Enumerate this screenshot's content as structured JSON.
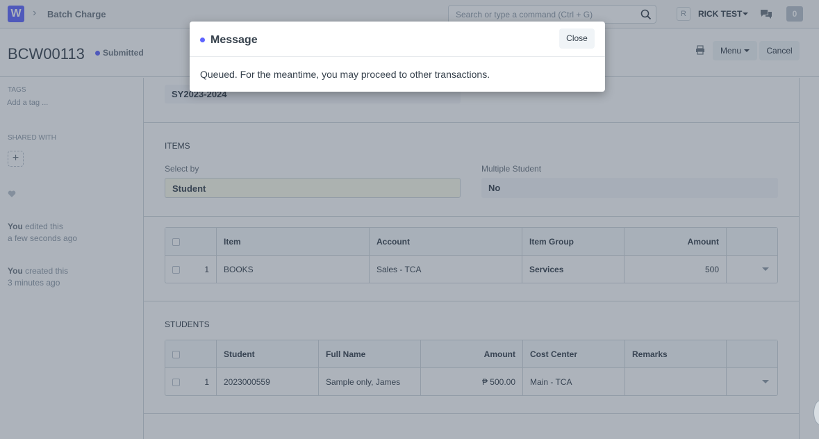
{
  "navbar": {
    "logo": "W",
    "breadcrumb": "Batch Charge",
    "search_placeholder": "Search or type a command (Ctrl + G)",
    "avatar_initial": "R",
    "user_name": "RICK TEST",
    "notification_count": "0"
  },
  "page": {
    "title": "BCW00113",
    "status": "Submitted",
    "menu_label": "Menu",
    "cancel_label": "Cancel"
  },
  "sidebar": {
    "tags_label": "TAGS",
    "add_tag": "Add a tag ...",
    "shared_label": "SHARED WITH",
    "plus": "+",
    "activity": [
      {
        "who": "You",
        "action": " edited this",
        "when": "a few seconds ago"
      },
      {
        "who": "You",
        "action": " created this",
        "when": "3 minutes ago"
      }
    ]
  },
  "form": {
    "school_year": "SY2023-2024",
    "items_section": "ITEMS",
    "select_by_label": "Select by",
    "select_by_value": "Student",
    "multiple_student_label": "Multiple Student",
    "multiple_student_value": "No",
    "items_table": {
      "headers": [
        "Item",
        "Account",
        "Item Group",
        "Amount"
      ],
      "rows": [
        {
          "idx": "1",
          "item": "BOOKS",
          "account": "Sales - TCA",
          "item_group": "Services",
          "amount": "500"
        }
      ]
    },
    "students_section": "STUDENTS",
    "students_table": {
      "headers": [
        "Student",
        "Full Name",
        "Amount",
        "Cost Center",
        "Remarks"
      ],
      "rows": [
        {
          "idx": "1",
          "student": "2023000559",
          "full_name": "Sample only, James",
          "amount": "₱ 500.00",
          "cost_center": "Main - TCA",
          "remarks": ""
        }
      ]
    }
  },
  "modal": {
    "title": "Message",
    "close_label": "Close",
    "body": "Queued. For the meantime, you may proceed to other transactions."
  },
  "colors": {
    "primary": "#5e64ff",
    "text": "#36414c",
    "muted": "#8d99a6",
    "border": "#d1d8dd"
  }
}
